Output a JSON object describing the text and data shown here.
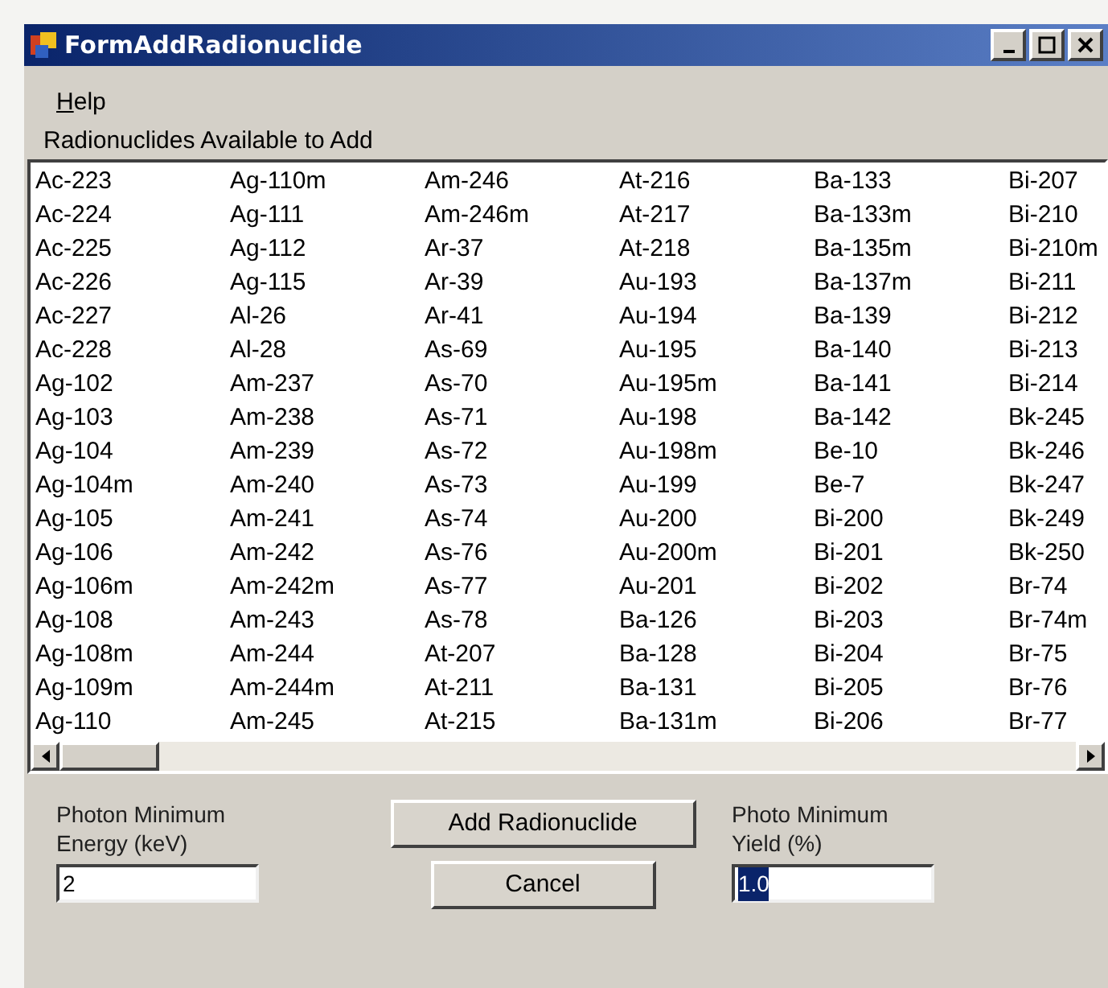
{
  "window": {
    "title": "FormAddRadionuclide"
  },
  "menu": [
    {
      "label": "Help",
      "mnemonic_underlined": true
    }
  ],
  "list_label": "Radionuclides Available to Add",
  "list_columns": [
    [
      "Ac-223",
      "Ac-224",
      "Ac-225",
      "Ac-226",
      "Ac-227",
      "Ac-228",
      "Ag-102",
      "Ag-103",
      "Ag-104",
      "Ag-104m",
      "Ag-105",
      "Ag-106",
      "Ag-106m",
      "Ag-108",
      "Ag-108m",
      "Ag-109m",
      "Ag-110"
    ],
    [
      "Ag-110m",
      "Ag-111",
      "Ag-112",
      "Ag-115",
      "Al-26",
      "Al-28",
      "Am-237",
      "Am-238",
      "Am-239",
      "Am-240",
      "Am-241",
      "Am-242",
      "Am-242m",
      "Am-243",
      "Am-244",
      "Am-244m",
      "Am-245"
    ],
    [
      "Am-246",
      "Am-246m",
      "Ar-37",
      "Ar-39",
      "Ar-41",
      "As-69",
      "As-70",
      "As-71",
      "As-72",
      "As-73",
      "As-74",
      "As-76",
      "As-77",
      "As-78",
      "At-207",
      "At-211",
      "At-215"
    ],
    [
      "At-216",
      "At-217",
      "At-218",
      "Au-193",
      "Au-194",
      "Au-195",
      "Au-195m",
      "Au-198",
      "Au-198m",
      "Au-199",
      "Au-200",
      "Au-200m",
      "Au-201",
      "Ba-126",
      "Ba-128",
      "Ba-131",
      "Ba-131m"
    ],
    [
      "Ba-133",
      "Ba-133m",
      "Ba-135m",
      "Ba-137m",
      "Ba-139",
      "Ba-140",
      "Ba-141",
      "Ba-142",
      "Be-10",
      "Be-7",
      "Bi-200",
      "Bi-201",
      "Bi-202",
      "Bi-203",
      "Bi-204",
      "Bi-205",
      "Bi-206"
    ],
    [
      "Bi-207",
      "Bi-210",
      "Bi-210m",
      "Bi-211",
      "Bi-212",
      "Bi-213",
      "Bi-214",
      "Bk-245",
      "Bk-246",
      "Bk-247",
      "Bk-249",
      "Bk-250",
      "Br-74",
      "Br-74m",
      "Br-75",
      "Br-76",
      "Br-77"
    ]
  ],
  "energy_field": {
    "label": "Photon Minimum Energy (keV)",
    "value": "2",
    "text_selected": false
  },
  "buttons": [
    "Add Radionuclide",
    "Cancel"
  ],
  "yield_field": {
    "label": "Photo Minimum Yield (%)",
    "value": "1.0",
    "text_selected": true
  }
}
